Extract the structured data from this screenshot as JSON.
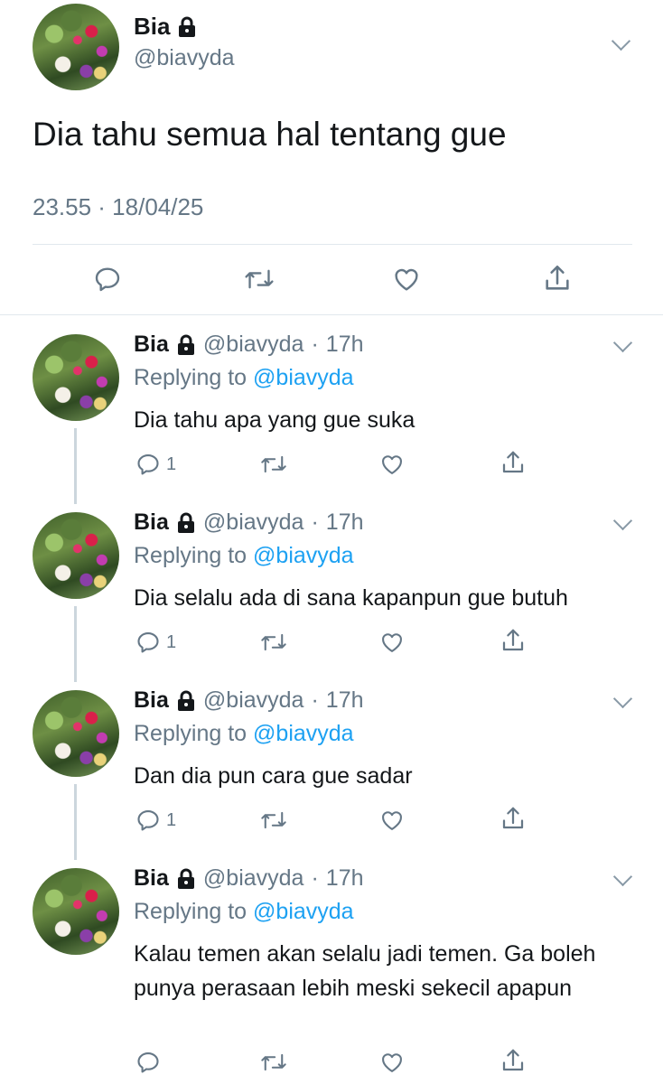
{
  "main_tweet": {
    "name": "Bia",
    "handle": "@biavyda",
    "text": "Dia tahu semua hal tentang gue",
    "meta": "23.55 · 18/04/25"
  },
  "replies": [
    {
      "name": "Bia",
      "handle": "@biavyda",
      "sep": "·",
      "time": "17h",
      "replying_prefix": "Replying to",
      "replying_to": "@biavyda",
      "text": "Dia tahu apa yang gue suka",
      "reply_count": "1"
    },
    {
      "name": "Bia",
      "handle": "@biavyda",
      "sep": "·",
      "time": "17h",
      "replying_prefix": "Replying to",
      "replying_to": "@biavyda",
      "text": "Dia selalu ada di sana kapanpun gue butuh",
      "reply_count": "1"
    },
    {
      "name": "Bia",
      "handle": "@biavyda",
      "sep": "·",
      "time": "17h",
      "replying_prefix": "Replying to",
      "replying_to": "@biavyda",
      "text": "Dan dia pun cara gue sadar",
      "reply_count": "1"
    },
    {
      "name": "Bia",
      "handle": "@biavyda",
      "sep": "·",
      "time": "17h",
      "replying_prefix": "Replying to",
      "replying_to": "@biavyda",
      "text": "Kalau temen akan selalu jadi temen. Ga boleh punya perasaan lebih meski sekecil apapun",
      "reply_count": ""
    }
  ],
  "icons": {
    "reply": "reply-icon",
    "retweet": "retweet-icon",
    "like": "heart-icon",
    "share": "share-icon",
    "lock": "lock-icon",
    "more": "chevron-down-icon"
  },
  "colors": {
    "text": "#14171a",
    "secondary": "#657786",
    "link": "#1da1f2",
    "divider": "#e1e8ed",
    "icon": "#657786"
  }
}
